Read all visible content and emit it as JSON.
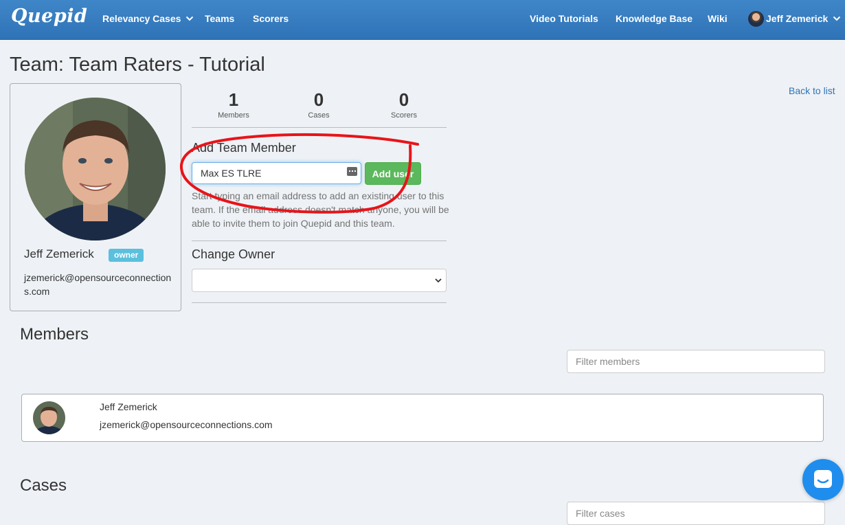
{
  "navbar": {
    "brand": "Quepid",
    "items_left": [
      "Relevancy Cases",
      "Teams",
      "Scorers"
    ],
    "items_right": [
      "Video Tutorials",
      "Knowledge Base",
      "Wiki"
    ],
    "user": "Jeff Zemerick"
  },
  "page": {
    "title": "Team: Team Raters - Tutorial",
    "back_link": "Back to list"
  },
  "owner": {
    "name": "Jeff Zemerick",
    "badge": "owner",
    "email": "jzemerick@opensourceconnections.com"
  },
  "stats": [
    {
      "value": "1",
      "label": "Members"
    },
    {
      "value": "0",
      "label": "Cases"
    },
    {
      "value": "0",
      "label": "Scorers"
    }
  ],
  "add_member": {
    "heading": "Add Team Member",
    "input_value": "Max ES TLRE",
    "button": "Add user",
    "help": "Start typing an email address to add an existing user to this team. If the email address doesn't match anyone, you will be able to invite them to join Quepid and this team."
  },
  "change_owner": {
    "heading": "Change Owner",
    "selected": ""
  },
  "members": {
    "heading": "Members",
    "filter_placeholder": "Filter members",
    "list": [
      {
        "name": "Jeff Zemerick",
        "email": "jzemerick@opensourceconnections.com"
      }
    ]
  },
  "cases": {
    "heading": "Cases",
    "filter_placeholder": "Filter cases"
  },
  "colors": {
    "navbar": "#3579bd",
    "primary_link": "#2f73b7",
    "success": "#5cb85c",
    "info_badge": "#5bc0de",
    "annotation": "#e8141a"
  }
}
